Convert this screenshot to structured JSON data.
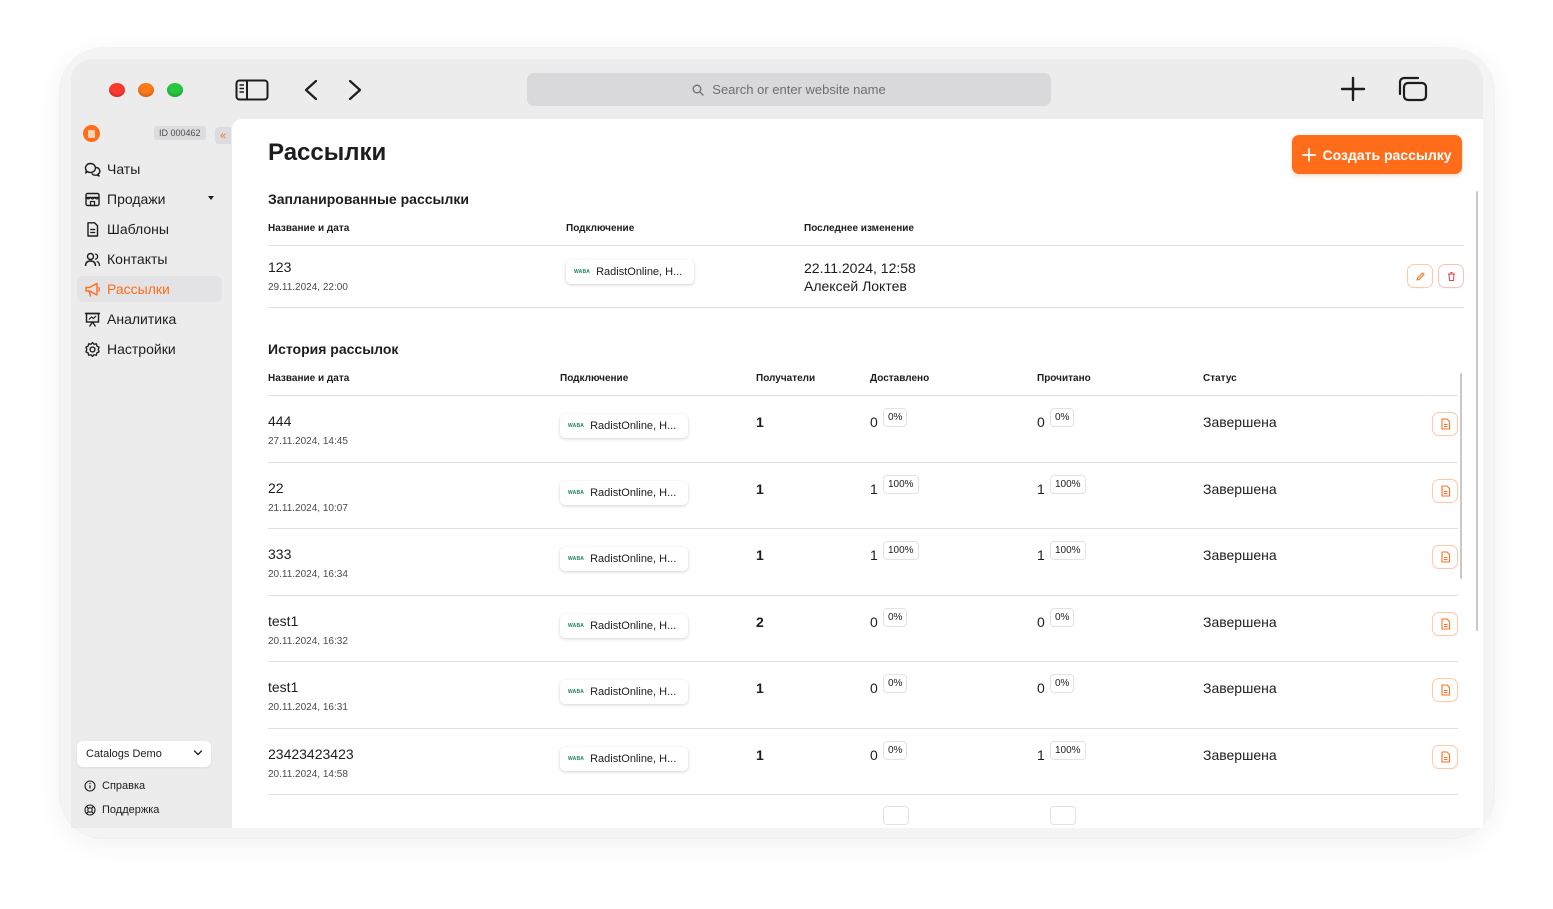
{
  "browser": {
    "search_placeholder": "Search or enter website name"
  },
  "sidebar": {
    "account_id": "ID 000462",
    "collapse_label": "«",
    "items": [
      {
        "label": "Чаты",
        "icon": "chat-icon"
      },
      {
        "label": "Продажи",
        "icon": "store-icon"
      },
      {
        "label": "Шаблоны",
        "icon": "document-icon"
      },
      {
        "label": "Контакты",
        "icon": "users-icon"
      },
      {
        "label": "Рассылки",
        "icon": "megaphone-icon",
        "active": true
      },
      {
        "label": "Аналитика",
        "icon": "presentation-icon"
      },
      {
        "label": "Настройки",
        "icon": "gear-icon"
      }
    ],
    "workspace": "Catalogs Demo",
    "help_label": "Справка",
    "support_label": "Поддержка"
  },
  "main": {
    "title": "Рассылки",
    "create_button": "Создать рассылку",
    "scheduled": {
      "title": "Запланированные рассылки",
      "columns": [
        "Название и дата",
        "Подключение",
        "Последнее изменение"
      ],
      "rows": [
        {
          "name": "123",
          "date": "29.11.2024, 22:00",
          "connection": "RadistOnline, Н...",
          "changed_at": "22.11.2024, 12:58",
          "changed_by": "Алексей Локтев"
        }
      ]
    },
    "history": {
      "title": "История рассылок",
      "columns": [
        "Название и дата",
        "Подключение",
        "Получатели",
        "Доставлено",
        "Прочитано",
        "Статус"
      ],
      "rows": [
        {
          "name": "444",
          "date": "27.11.2024, 14:45",
          "connection": "RadistOnline, Н...",
          "recipients": "1",
          "delivered": "0",
          "delivered_pct": "0%",
          "read": "0",
          "read_pct": "0%",
          "status": "Завершена"
        },
        {
          "name": "22",
          "date": "21.11.2024, 10:07",
          "connection": "RadistOnline, Н...",
          "recipients": "1",
          "delivered": "1",
          "delivered_pct": "100%",
          "read": "1",
          "read_pct": "100%",
          "status": "Завершена"
        },
        {
          "name": "333",
          "date": "20.11.2024, 16:34",
          "connection": "RadistOnline, Н...",
          "recipients": "1",
          "delivered": "1",
          "delivered_pct": "100%",
          "read": "1",
          "read_pct": "100%",
          "status": "Завершена"
        },
        {
          "name": "test1",
          "date": "20.11.2024, 16:32",
          "connection": "RadistOnline, Н...",
          "recipients": "2",
          "delivered": "0",
          "delivered_pct": "0%",
          "read": "0",
          "read_pct": "0%",
          "status": "Завершена"
        },
        {
          "name": "test1",
          "date": "20.11.2024, 16:31",
          "connection": "RadistOnline, Н...",
          "recipients": "1",
          "delivered": "0",
          "delivered_pct": "0%",
          "read": "0",
          "read_pct": "0%",
          "status": "Завершена"
        },
        {
          "name": "23423423423",
          "date": "20.11.2024, 14:58",
          "connection": "RadistOnline, Н...",
          "recipients": "1",
          "delivered": "0",
          "delivered_pct": "0%",
          "read": "1",
          "read_pct": "100%",
          "status": "Завершена"
        }
      ]
    },
    "wa_badge": "WABA"
  },
  "colors": {
    "accent": "#ff6d1b",
    "traffic_red": "#ff3b30",
    "traffic_orange": "#ff7a1a",
    "traffic_green": "#28c840"
  }
}
